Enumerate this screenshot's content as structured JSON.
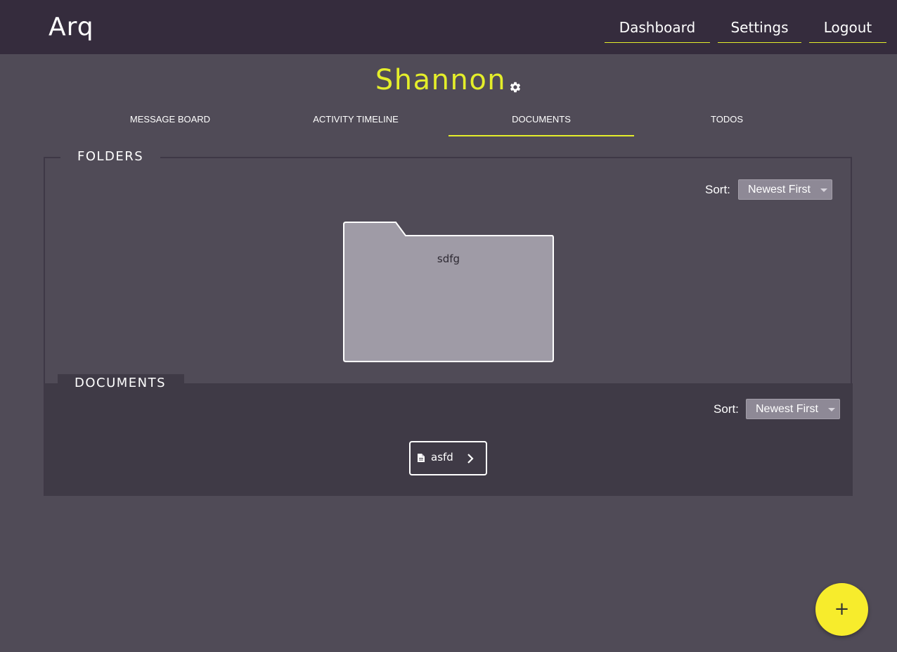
{
  "app": {
    "logo": "Arq"
  },
  "header": {
    "nav": {
      "dashboard": "Dashboard",
      "settings": "Settings",
      "logout": "Logout"
    }
  },
  "project": {
    "title": "Shannon",
    "settings_icon": "gear-icon"
  },
  "tabs": [
    {
      "label": "MESSAGE BOARD",
      "active": false
    },
    {
      "label": "ACTIVITY TIMELINE",
      "active": false
    },
    {
      "label": "DOCUMENTS",
      "active": true
    },
    {
      "label": "TODOS",
      "active": false
    }
  ],
  "folders": {
    "heading": "FOLDERS",
    "sort_label": "Sort:",
    "sort_value": "Newest First",
    "items": [
      {
        "name": "sdfg"
      }
    ]
  },
  "documents": {
    "heading": "DOCUMENTS",
    "sort_label": "Sort:",
    "sort_value": "Newest First",
    "items": [
      {
        "name": "asfd",
        "icon": "document-icon"
      }
    ]
  },
  "fab": {
    "label": "+",
    "icon": "plus-icon"
  },
  "colors": {
    "accent": "#e4ee2a",
    "fab": "#f7ec2c",
    "header_bg": "#352c3d",
    "page_bg": "#504b57",
    "panel_bg": "#3f3a46",
    "folder_fill": "#9f9ba6"
  }
}
